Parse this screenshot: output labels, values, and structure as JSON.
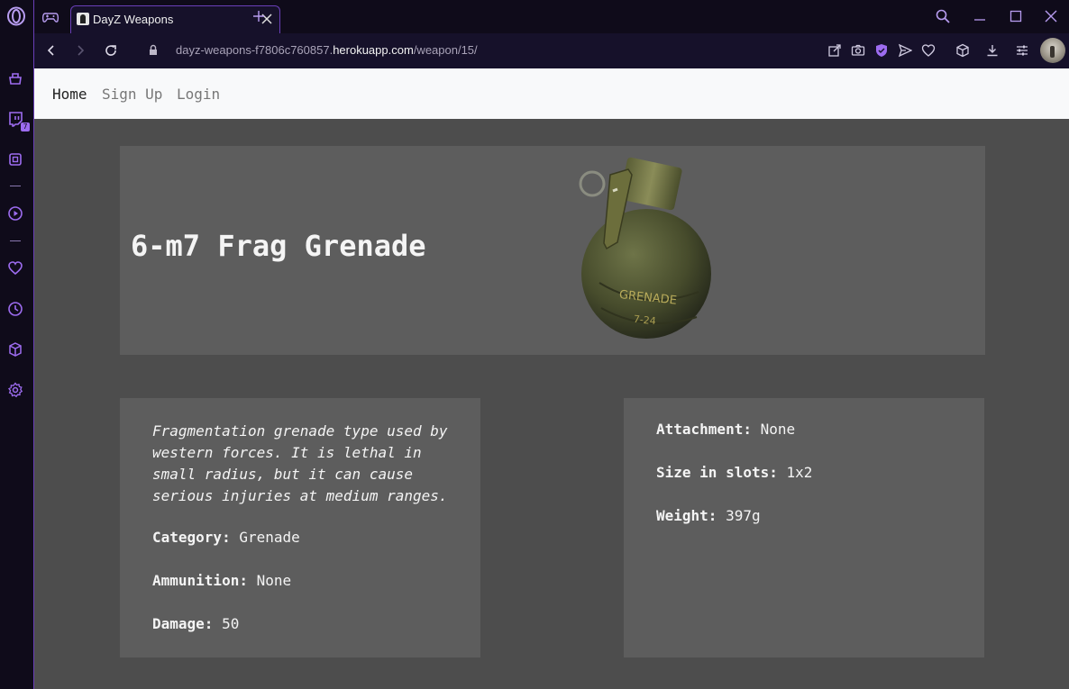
{
  "browser": {
    "tab_title": "DayZ Weapons",
    "sidebar_badge": "7",
    "url_prefix": "dayz-weapons-f7806c760857.",
    "url_host": "herokuapp.com",
    "url_path": "/weapon/15/"
  },
  "nav": {
    "home": "Home",
    "signup": "Sign Up",
    "login": "Login"
  },
  "weapon": {
    "name": "6-m7 Frag Grenade",
    "description": "Fragmentation grenade type used by western forces. It is lethal in small radius, but it can cause serious injuries at medium ranges.",
    "category_label": "Category:",
    "category": "Grenade",
    "ammunition_label": "Ammunition:",
    "ammunition": "None",
    "damage_label": "Damage:",
    "damage": "50",
    "attachment_label": "Attachment:",
    "attachment": "None",
    "size_label": "Size in slots:",
    "size": "1x2",
    "weight_label": "Weight:",
    "weight": "397g",
    "image_text_1": "GRENADE",
    "image_text_2": "7-24"
  },
  "colors": {
    "accent": "#9d6cf0",
    "page_bg": "#4d4d4d",
    "card_bg": "#5d5d5d"
  }
}
